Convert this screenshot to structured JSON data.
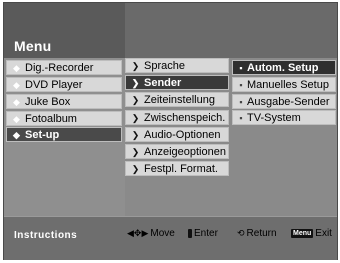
{
  "menu": {
    "title": "Menu"
  },
  "column1": [
    {
      "label": "Dig.-Recorder"
    },
    {
      "label": "DVD Player"
    },
    {
      "label": "Juke Box"
    },
    {
      "label": "Fotoalbum"
    },
    {
      "label": "Set-up"
    }
  ],
  "column2": [
    {
      "label": "Sprache"
    },
    {
      "label": "Sender"
    },
    {
      "label": "Zeiteinstellung"
    },
    {
      "label": "Zwischenspeich."
    },
    {
      "label": "Audio-Optionen"
    },
    {
      "label": "Anzeigeoptionen"
    },
    {
      "label": "Festpl. Format."
    }
  ],
  "column3": [
    {
      "label": "Autom. Setup"
    },
    {
      "label": "Manuelles Setup"
    },
    {
      "label": "Ausgabe-Sender"
    },
    {
      "label": "TV-System"
    }
  ],
  "instructions": {
    "label": "Instructions",
    "move": "Move",
    "enter_key": "",
    "enter": "Enter",
    "return": "Return",
    "exit_key": "Menu",
    "exit": "Exit"
  }
}
